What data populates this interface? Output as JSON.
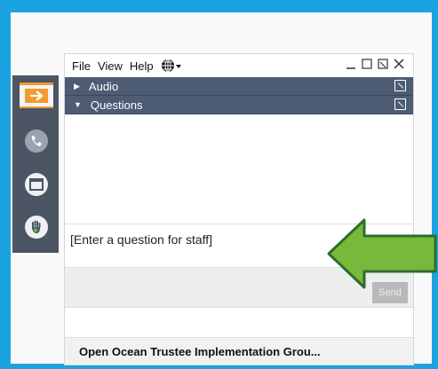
{
  "menu": {
    "file": "File",
    "view": "View",
    "help": "Help"
  },
  "sections": {
    "audio": "Audio",
    "questions": "Questions"
  },
  "question_input": {
    "placeholder": "[Enter a question for staff]"
  },
  "send_label": "Send",
  "footer_title": "Open Ocean Trustee Implementation Grou...",
  "colors": {
    "background": "#1aa3e0",
    "section_bar": "#4d5b73",
    "strip": "#4b5564",
    "arrow": "#78b83a",
    "accent": "#f39a2e"
  },
  "icons": [
    "globe-icon",
    "minimize-icon",
    "restore-icon",
    "popout-icon",
    "close-icon",
    "orange-arrow-icon",
    "phone-icon",
    "window-icon",
    "hand-icon",
    "green-arrow-icon"
  ]
}
